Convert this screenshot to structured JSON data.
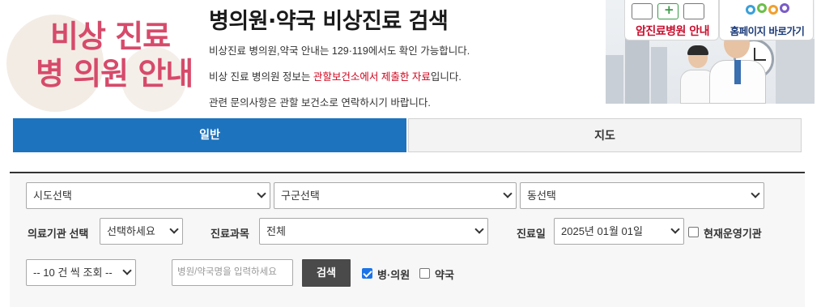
{
  "header": {
    "logo_line1": "비상 진료",
    "logo_line2": "병 의원 안내",
    "title": "병의원·약국 비상진료 검색",
    "info1": "비상진료 병의원,약국 안내는 129·119에서도 확인 가능합니다.",
    "info2_pre": "비상 진료 병의원 정보는 ",
    "info2_highlight": "관할보건소에서 제출한 자료",
    "info2_post": "입니다.",
    "info3": "관련 문의사항은 관할 보건소로 연락하시기 바랍니다.",
    "badge_er": "암진료병원 안내",
    "badge_homepage": "홈페이지 바로가기"
  },
  "tabs": {
    "general": "일반",
    "map": "지도"
  },
  "search": {
    "sido": "시도선택",
    "gugun": "구군선택",
    "dong": "동선택",
    "org_type_label": "의료기관 선택",
    "org_type_value": "선택하세요",
    "dept_label": "진료과목",
    "dept_value": "전체",
    "date_label": "진료일",
    "date_value": "2025년 01월 01일",
    "open_now_label": "현재운영기관",
    "page_size": "-- 10 건 씩 조회 --",
    "name_placeholder": "병원/약국명을 입력하세요",
    "search_button": "검색",
    "hospital_label": "병·의원",
    "pharmacy_label": "약국",
    "hospital_checked": true,
    "pharmacy_checked": false,
    "open_now_checked": false
  },
  "colors": {
    "primary": "#1e73be",
    "logo_pink": "#d64a6a",
    "highlight_red": "#d0021b"
  }
}
